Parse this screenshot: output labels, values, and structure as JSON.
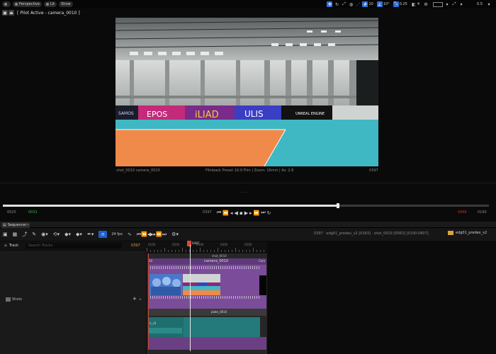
{
  "viewport_toolbar": {
    "perspective": "Perspective",
    "lit": "Lit",
    "show": "Show",
    "snap_translate": "10",
    "snap_rotate": "10°",
    "snap_scale": "0.25",
    "camera_speed": "4",
    "fov": "0.5"
  },
  "pilot": {
    "label": "[ Pilot Active - camera_0010 ]"
  },
  "camera_caption": {
    "left": "shot_0010 camera_0010",
    "center": "Filmback Preset 16:9 Film | Zoom: 16mm | Av: 2.8",
    "right": "0397"
  },
  "transport": {
    "start_tc": "0025",
    "in_tc": "0031",
    "current_tc": "0397",
    "end_tc": "0966",
    "out_tc": "0160"
  },
  "sequencer": {
    "tab_label": "Sequencer",
    "fps": "24 fps",
    "breadcrumb": "0397 · edg01_predex_v2 [0393] · shot_0010 [0063] [0100-0807]",
    "sequence_name": "edg01_predex_v2",
    "add_track": "Track",
    "search_placeholder": "Search Tracks",
    "track_time": "0397",
    "playhead": "0397",
    "ruler_labels": [
      "0100",
      "0200",
      "0300",
      "0400",
      "0500"
    ],
    "shot_label": "shot_0010",
    "camera_clip": "camera_0010",
    "plate_label": "plate_0010",
    "sub_label": "n_v2",
    "tree_item": "Shots",
    "mini_left": "10",
    "mini_right": "Cam"
  }
}
